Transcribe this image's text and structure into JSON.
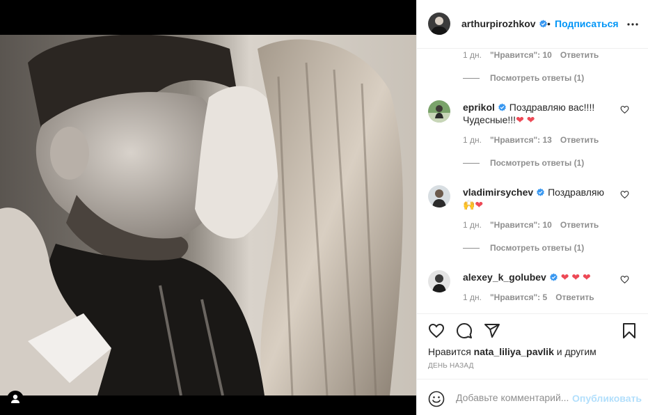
{
  "header": {
    "username": "arthurpirozhkov",
    "separator": "•",
    "follow_label": "Подписаться"
  },
  "first_meta": {
    "age": "1 дн.",
    "likes": "\"Нравится\": 10",
    "reply": "Ответить"
  },
  "first_view_replies": "Посмотреть ответы (1)",
  "comments": [
    {
      "username": "eprikol",
      "text": "Поздравляю вас!!!! Чудесные!!!",
      "emoji": "❤ ❤",
      "age": "1 дн.",
      "likes": "\"Нравится\": 13",
      "reply": "Ответить",
      "view_replies": "Посмотреть ответы (1)"
    },
    {
      "username": "vladimirsychev",
      "text": "Поздравляю",
      "emoji": "🙌❤",
      "age": "1 дн.",
      "likes": "\"Нравится\": 10",
      "reply": "Ответить",
      "view_replies": "Посмотреть ответы (1)"
    },
    {
      "username": "alexey_k_golubev",
      "text": "",
      "emoji": "❤ ❤ ❤",
      "age": "1 дн.",
      "likes": "\"Нравится\": 5",
      "reply": "Ответить"
    }
  ],
  "likes_line": {
    "prefix": "Нравится",
    "user": "nata_liliya_pavlik",
    "suffix": "и другим"
  },
  "post_date": "ДЕНЬ НАЗАД",
  "comment_box": {
    "placeholder": "Добавьте комментарий...",
    "publish_label": "Опубликовать"
  },
  "colors": {
    "link_blue": "#0095f6",
    "publish_disabled": "#b2dffc",
    "verified_blue": "#3897f0",
    "heart_red": "#ed4956",
    "secondary_text": "#8e8e8e"
  },
  "icons": [
    "tag-user-icon",
    "verified-icon",
    "more-options-icon",
    "heart-icon",
    "comment-icon",
    "share-icon",
    "bookmark-icon",
    "emoji-icon"
  ]
}
